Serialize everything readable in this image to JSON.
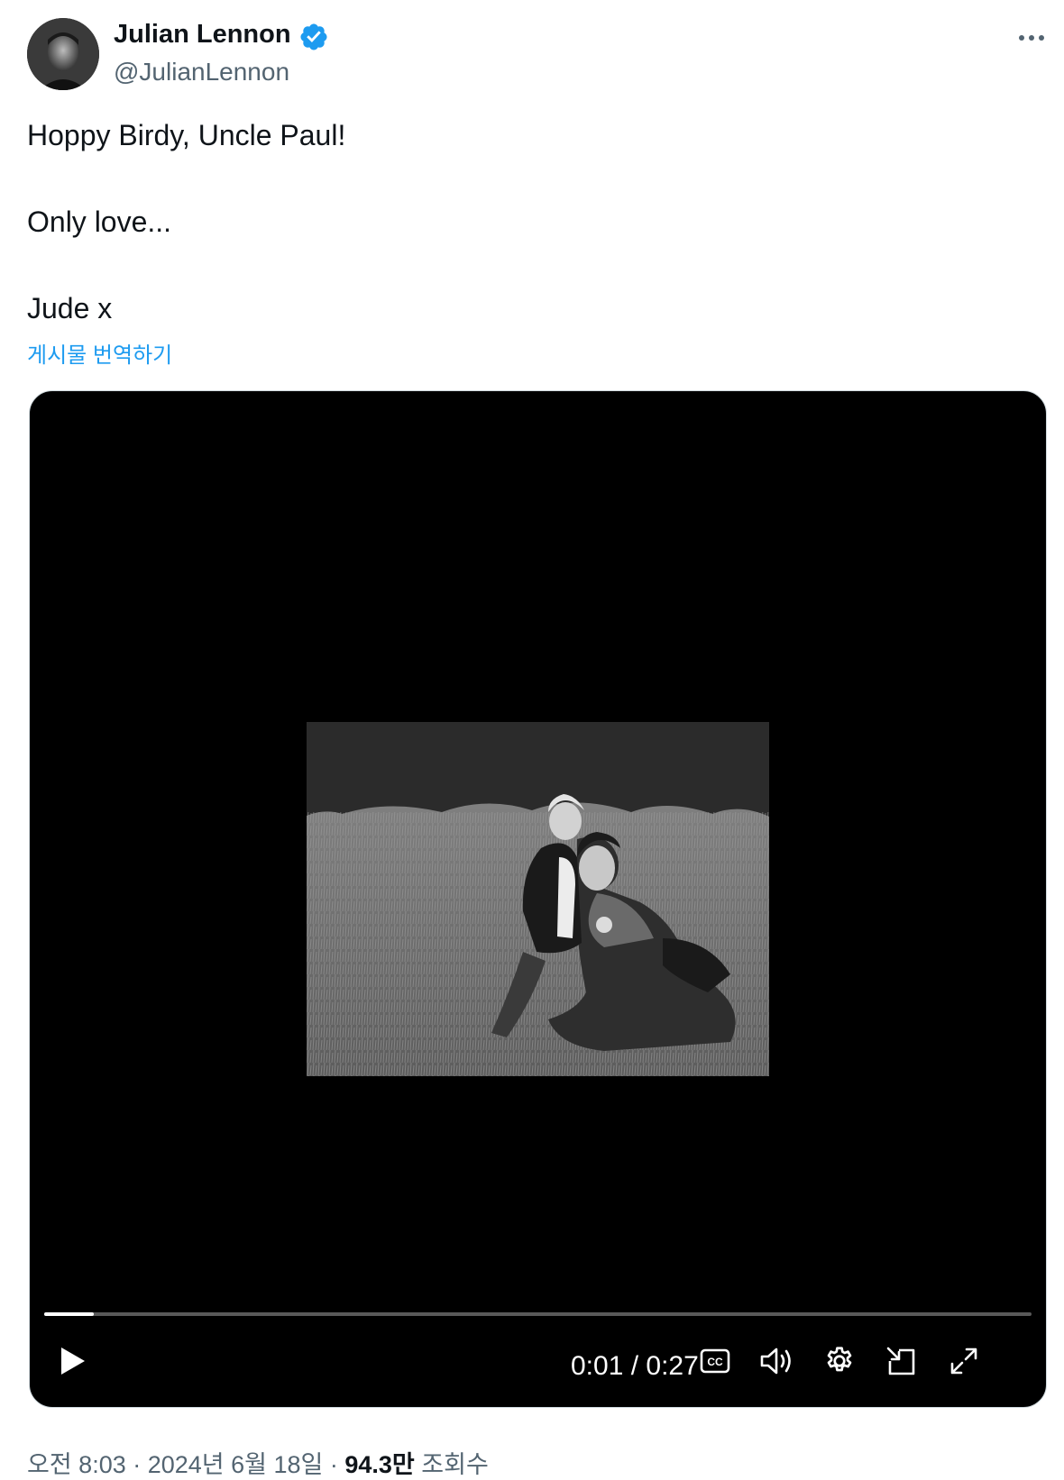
{
  "author": {
    "display_name": "Julian Lennon",
    "handle": "@JulianLennon",
    "verified_icon": "verified-badge-icon",
    "verified_color": "#1d9bf0"
  },
  "tweet": {
    "lines": [
      "Hoppy Birdy, Uncle Paul!",
      "Only love...",
      "Jude x"
    ],
    "translate_label": "게시물 번역하기"
  },
  "video": {
    "current_time": "0:01",
    "duration": "0:27",
    "time_separator": " / ",
    "progress": 0.05
  },
  "meta": {
    "time": "오전 8:03",
    "date": "2024년 6월 18일",
    "separator": " · ",
    "views_count": "94.3만",
    "views_label": "조회수"
  },
  "colors": {
    "link": "#1d9bf0",
    "secondary_text": "#536471",
    "primary_text": "#0f1419",
    "video_bg": "#000000"
  }
}
